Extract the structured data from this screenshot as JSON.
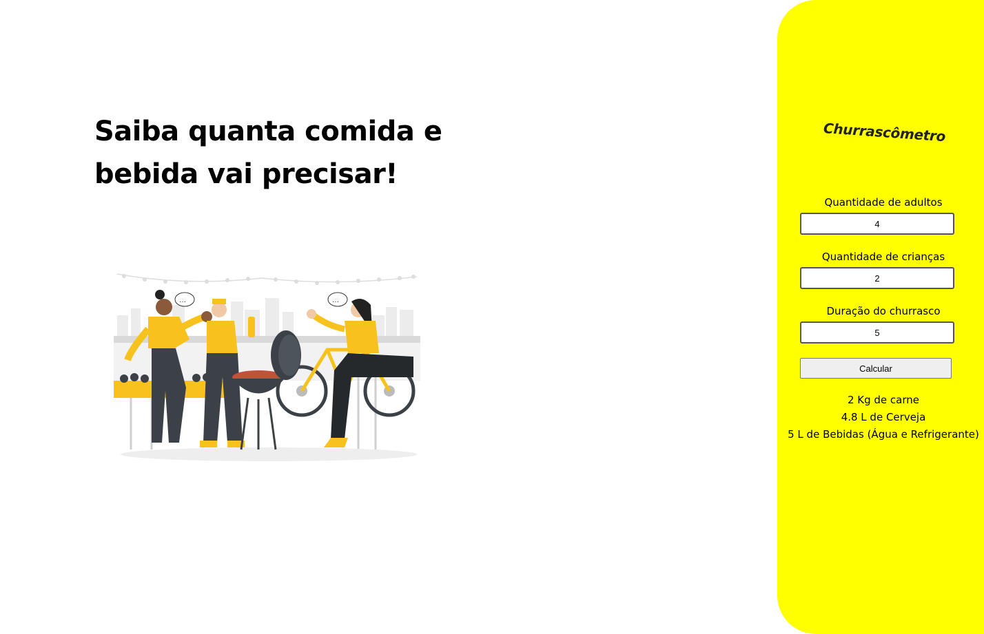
{
  "hero": {
    "line1": "Saiba quanta comida e",
    "line2": "bebida vai precisar!"
  },
  "illustration": {
    "description_icon": "barbecue-party-illustration",
    "colors": {
      "accent": "#f7c21e",
      "dark": "#3b4146",
      "skin": "#8a5a3b"
    }
  },
  "panel": {
    "background": "#ffff00",
    "logo_text": "Churrascômetro",
    "fields": [
      {
        "label": "Quantidade de adultos",
        "value": "4"
      },
      {
        "label": "Quantidade de crianças",
        "value": "2"
      },
      {
        "label": "Duração do churrasco",
        "value": "5"
      }
    ],
    "button_label": "Calcular",
    "results": [
      "2 Kg de carne",
      "4.8 L de Cerveja",
      "5 L de Bebidas (Água e Refrigerante)"
    ]
  }
}
